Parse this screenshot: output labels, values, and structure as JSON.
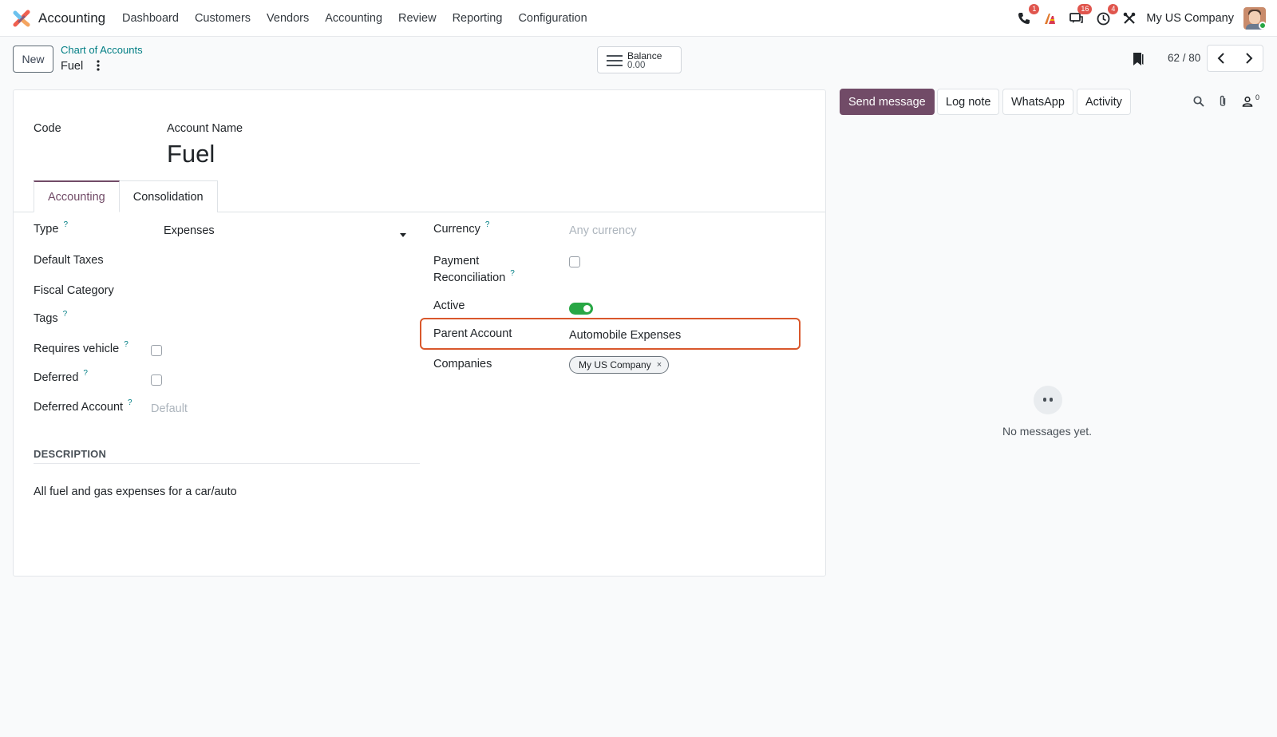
{
  "navbar": {
    "app_name": "Accounting",
    "menu": [
      "Dashboard",
      "Customers",
      "Vendors",
      "Accounting",
      "Review",
      "Reporting",
      "Configuration"
    ],
    "badges": {
      "phone": "1",
      "messages": "16",
      "activities": "4"
    },
    "company": "My US Company"
  },
  "control": {
    "new_label": "New",
    "breadcrumb_parent": "Chart of Accounts",
    "breadcrumb_current": "Fuel",
    "balance_label": "Balance",
    "balance_value": "0.00",
    "pager": "62 / 80"
  },
  "form": {
    "code_label": "Code",
    "account_name_label": "Account Name",
    "account_name": "Fuel",
    "tabs": [
      "Accounting",
      "Consolidation"
    ],
    "help_mark": "?",
    "left": {
      "type_label": "Type",
      "type_value": "Expenses",
      "default_taxes_label": "Default Taxes",
      "fiscal_category_label": "Fiscal Category",
      "tags_label": "Tags",
      "requires_vehicle_label": "Requires vehicle",
      "deferred_label": "Deferred",
      "deferred_account_label": "Deferred Account",
      "deferred_account_placeholder": "Default"
    },
    "right": {
      "currency_label": "Currency",
      "currency_placeholder": "Any currency",
      "payment_label_1": "Payment",
      "payment_label_2": "Reconciliation",
      "active_label": "Active",
      "parent_account_label": "Parent Account",
      "parent_account_value": "Automobile Expenses",
      "companies_label": "Companies",
      "company_tag": "My US Company",
      "tag_remove": "×"
    },
    "description_title": "DESCRIPTION",
    "description_text": "All fuel and gas expenses for a car/auto"
  },
  "chatter": {
    "send_message": "Send message",
    "log_note": "Log note",
    "whatsapp": "WhatsApp",
    "activity": "Activity",
    "followers_count": "0",
    "empty_text": "No messages yet."
  },
  "colors": {
    "brand": "#714b67",
    "link": "#017e84",
    "highlight": "#d9582c",
    "toggle_on": "#28a745",
    "badge": "#e0554d"
  }
}
